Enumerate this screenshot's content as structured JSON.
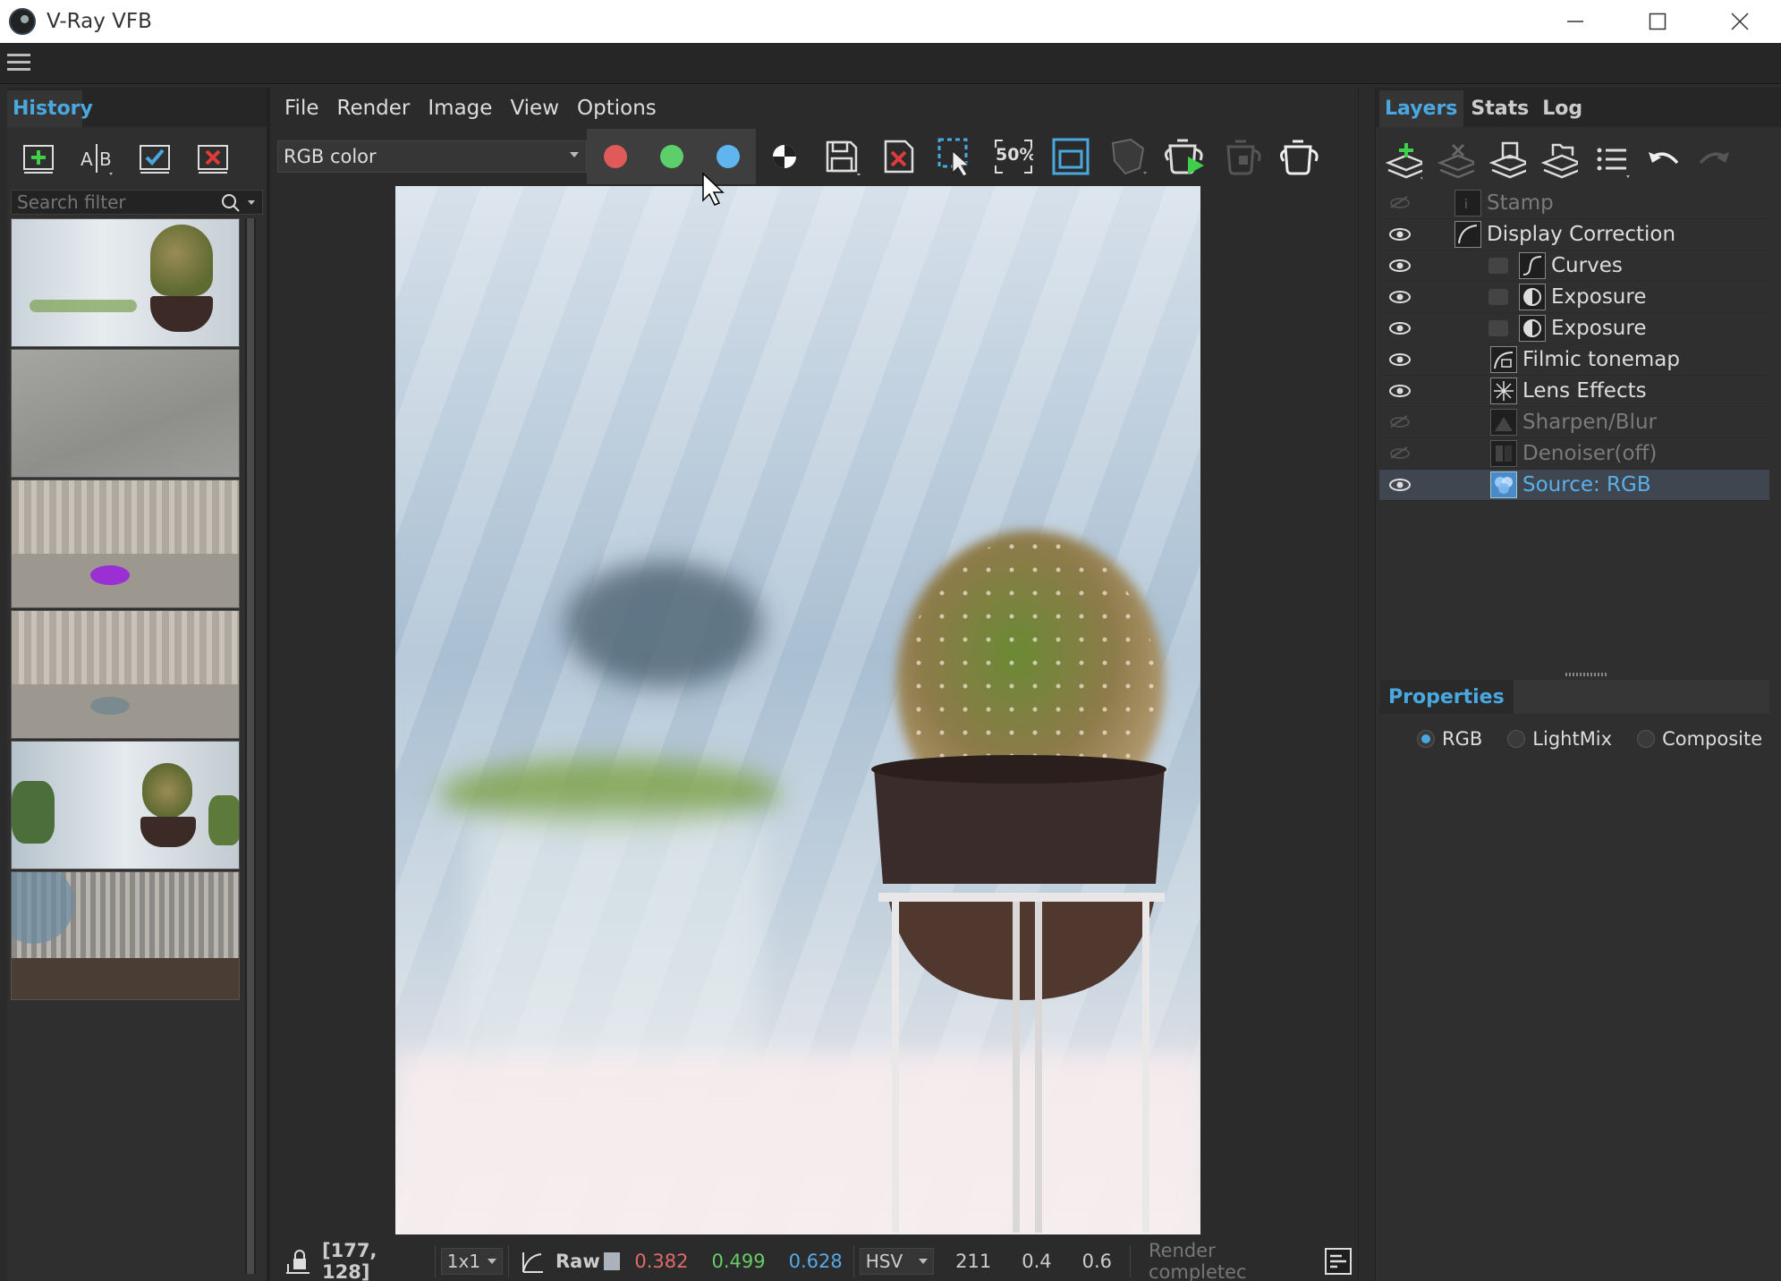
{
  "window": {
    "title": "V-Ray VFB"
  },
  "history": {
    "tab": "History",
    "search_placeholder": "Search filter",
    "tools": [
      "add-history-icon",
      "ab-compare-icon",
      "check-icon",
      "delete-icon"
    ]
  },
  "menu": {
    "items": [
      "File",
      "Render",
      "Image",
      "View",
      "Options"
    ]
  },
  "toolbar": {
    "channel": "RGB color",
    "channel_colors": {
      "red": "#e05a5a",
      "green": "#5ccf6a",
      "blue": "#5fb6ee"
    },
    "zoom_label": "50%"
  },
  "status": {
    "coords": "[177, 128]",
    "ratio": "1x1",
    "raw_label": "Raw",
    "r": "0.382",
    "g": "0.499",
    "b": "0.628",
    "colorspace": "HSV",
    "h": "211",
    "s": "0.4",
    "v": "0.6",
    "message": "Render completec",
    "r_color": "#e36a6a",
    "g_color": "#66cc66",
    "b_color": "#58a9e8"
  },
  "right": {
    "tabs": [
      "Layers",
      "Stats",
      "Log"
    ],
    "layers": [
      {
        "name": "Stamp",
        "visible": false
      },
      {
        "name": "Display Correction",
        "visible": true
      },
      {
        "name": "Curves",
        "visible": true
      },
      {
        "name": "Exposure",
        "visible": true
      },
      {
        "name": "Exposure",
        "visible": true
      },
      {
        "name": "Filmic tonemap",
        "visible": true
      },
      {
        "name": "Lens Effects",
        "visible": true
      },
      {
        "name": "Sharpen/Blur",
        "visible": false
      },
      {
        "name": "Denoiser(off)",
        "visible": false
      },
      {
        "name": "Source: RGB",
        "visible": true
      }
    ],
    "properties_title": "Properties",
    "radio_options": [
      "RGB",
      "LightMix",
      "Composite"
    ],
    "radio_selected": "RGB"
  },
  "accent": "#4aa8e0"
}
